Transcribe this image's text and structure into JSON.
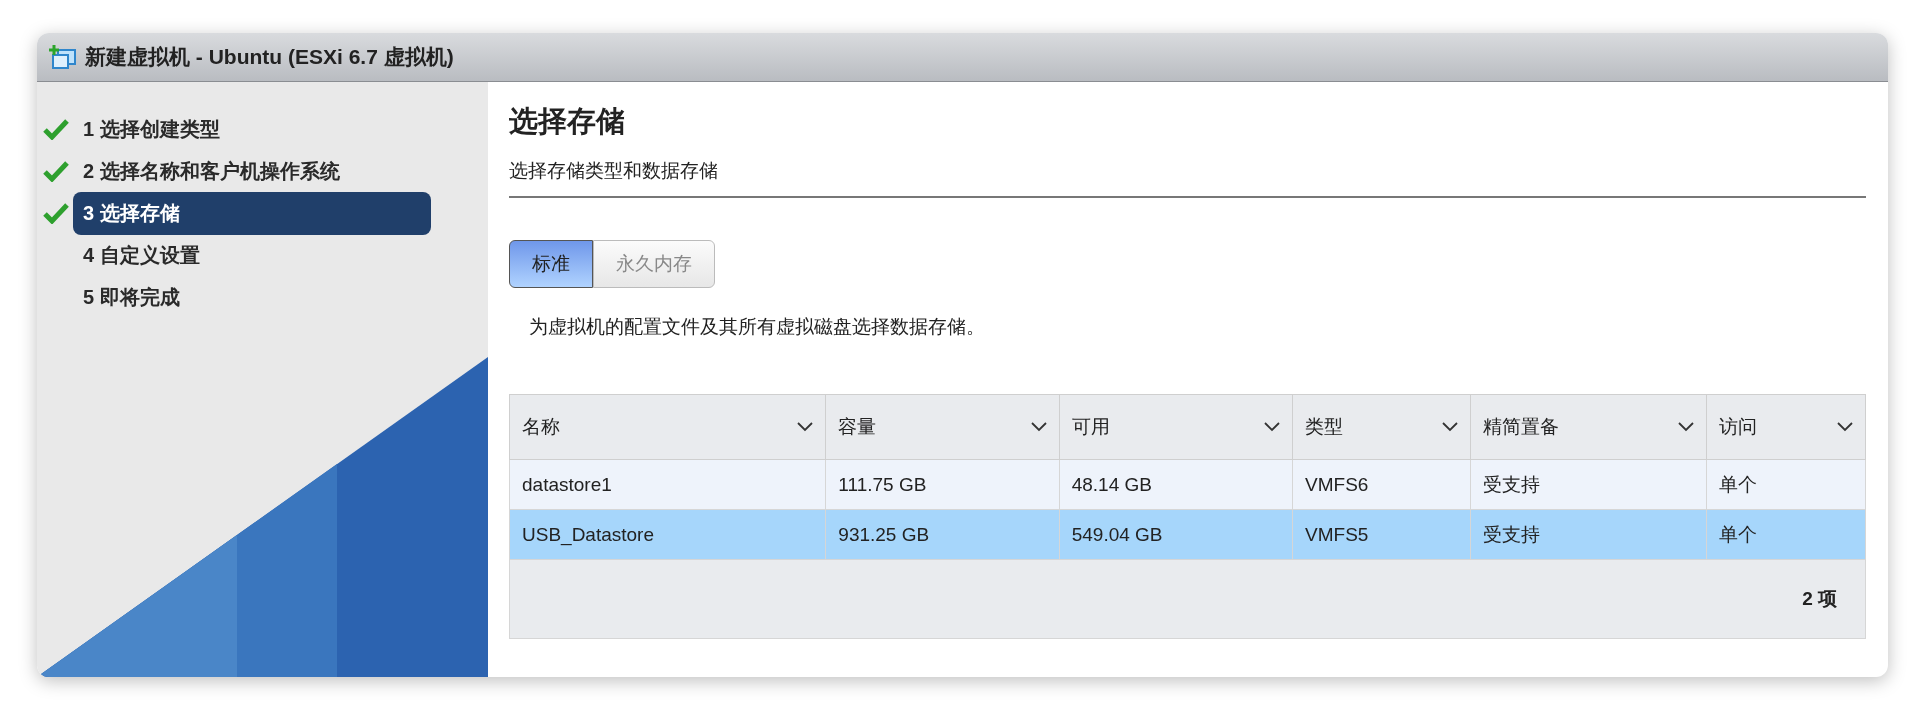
{
  "window": {
    "title": "新建虚拟机 - Ubuntu (ESXi 6.7 虚拟机)"
  },
  "steps": [
    {
      "label": "1 选择创建类型",
      "done": true,
      "selected": false
    },
    {
      "label": "2 选择名称和客户机操作系统",
      "done": true,
      "selected": false
    },
    {
      "label": "3 选择存储",
      "done": true,
      "selected": true
    },
    {
      "label": "4 自定义设置",
      "done": false,
      "selected": false
    },
    {
      "label": "5 即将完成",
      "done": false,
      "selected": false
    }
  ],
  "page": {
    "heading": "选择存储",
    "subheading": "选择存储类型和数据存储"
  },
  "tabs": [
    {
      "label": "标准",
      "selected": true
    },
    {
      "label": "永久内存",
      "selected": false
    }
  ],
  "description": "为虚拟机的配置文件及其所有虚拟磁盘选择数据存储。",
  "table": {
    "columns": [
      "名称",
      "容量",
      "可用",
      "类型",
      "精简置备",
      "访问"
    ],
    "rows": [
      {
        "cells": [
          "datastore1",
          "111.75 GB",
          "48.14 GB",
          "VMFS6",
          "受支持",
          "单个"
        ],
        "selected": false
      },
      {
        "cells": [
          "USB_Datastore",
          "931.25 GB",
          "549.04 GB",
          "VMFS5",
          "受支持",
          "单个"
        ],
        "selected": true
      }
    ],
    "footer": "2 项"
  }
}
